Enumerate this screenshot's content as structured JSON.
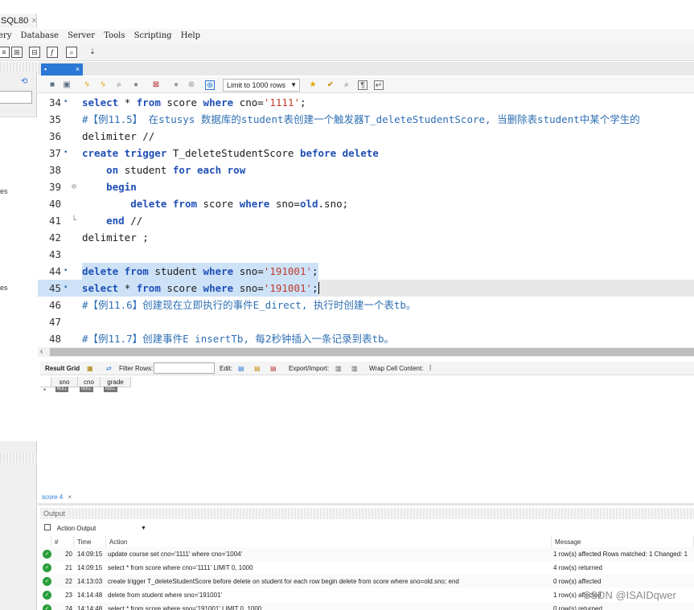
{
  "window_tab": {
    "title": "SQL80",
    "close": "×"
  },
  "menu": [
    "ery",
    "Database",
    "Server",
    "Tools",
    "Scripting",
    "Help"
  ],
  "left_panel": {
    "labels": [
      "es",
      "es"
    ]
  },
  "editor": {
    "tab_close": "×",
    "limit_select": "Limit to 1000 rows",
    "lines": [
      {
        "num": "34",
        "mark": "•",
        "tokens": [
          [
            "kw",
            "select "
          ],
          [
            "plain",
            "* "
          ],
          [
            "kw",
            "from "
          ],
          [
            "plain",
            "score "
          ],
          [
            "kw",
            "where "
          ],
          [
            "plain",
            "cno="
          ],
          [
            "str",
            "'1111'"
          ],
          [
            "plain",
            ";"
          ]
        ]
      },
      {
        "num": "35",
        "mark": "",
        "tokens": [
          [
            "cm",
            "#【例11.5】 在stusys 数据库的student表创建一个触发器T_deleteStudentScore, 当删除表student中某个学生的"
          ]
        ]
      },
      {
        "num": "36",
        "mark": "",
        "tokens": [
          [
            "plain",
            "delimiter //"
          ]
        ]
      },
      {
        "num": "37",
        "mark": "•",
        "tokens": [
          [
            "kw",
            "create trigger "
          ],
          [
            "plain",
            "T_deleteStudentScore "
          ],
          [
            "kw",
            "before delete"
          ]
        ]
      },
      {
        "num": "38",
        "mark": "",
        "tokens": [
          [
            "plain",
            "    "
          ],
          [
            "kw",
            "on "
          ],
          [
            "plain",
            "student "
          ],
          [
            "kw",
            "for each row"
          ]
        ]
      },
      {
        "num": "39",
        "mark": "",
        "fold": "⊖",
        "tokens": [
          [
            "plain",
            "    "
          ],
          [
            "kw",
            "begin"
          ]
        ]
      },
      {
        "num": "40",
        "mark": "",
        "tokens": [
          [
            "plain",
            "        "
          ],
          [
            "kw",
            "delete from "
          ],
          [
            "plain",
            "score "
          ],
          [
            "kw",
            "where "
          ],
          [
            "plain",
            "sno="
          ],
          [
            "kw",
            "old"
          ],
          [
            "plain",
            ".sno;"
          ]
        ]
      },
      {
        "num": "41",
        "mark": "",
        "fold": "└",
        "tokens": [
          [
            "plain",
            "    "
          ],
          [
            "kw",
            "end "
          ],
          [
            "plain",
            "//"
          ]
        ]
      },
      {
        "num": "42",
        "mark": "",
        "tokens": [
          [
            "plain",
            "delimiter ;"
          ]
        ]
      },
      {
        "num": "43",
        "mark": "",
        "tokens": [
          [
            "plain",
            ""
          ]
        ]
      },
      {
        "num": "44",
        "mark": "•",
        "sel": true,
        "tokens": [
          [
            "kw",
            "delete from "
          ],
          [
            "plain",
            "student "
          ],
          [
            "kw",
            "where "
          ],
          [
            "plain",
            "sno="
          ],
          [
            "str",
            "'191001'"
          ],
          [
            "plain",
            ";"
          ]
        ]
      },
      {
        "num": "45",
        "mark": "•",
        "sel": true,
        "cur": true,
        "tokens": [
          [
            "kw",
            "select "
          ],
          [
            "plain",
            "* "
          ],
          [
            "kw",
            "from "
          ],
          [
            "plain",
            "score "
          ],
          [
            "kw",
            "where "
          ],
          [
            "plain",
            "sno="
          ],
          [
            "str",
            "'191001'"
          ],
          [
            "plain",
            ";"
          ]
        ]
      },
      {
        "num": "46",
        "mark": "",
        "tokens": [
          [
            "cm",
            "#【例11.6】创建现在立即执行的事件E_direct, 执行时创建一个表tb。"
          ]
        ]
      },
      {
        "num": "47",
        "mark": "",
        "tokens": [
          [
            "plain",
            ""
          ]
        ]
      },
      {
        "num": "48",
        "mark": "",
        "tokens": [
          [
            "cm",
            "#【例11.7】创建事件E insertTb, 每2秒钟插入一条记录到表tb。"
          ]
        ]
      }
    ]
  },
  "result": {
    "toolbar": {
      "grid_label": "Result Grid",
      "filter_label": "Filter Rows:",
      "edit_label": "Edit:",
      "export_label": "Export/Import:",
      "wrap_label": "Wrap Cell Content:"
    },
    "columns": [
      "sno",
      "cno",
      "grade"
    ],
    "row_marker": "*",
    "null_label": "NULL"
  },
  "output": {
    "score_tab": "score 4",
    "score_tab_close": "×",
    "header": "Output",
    "select_value": "Action Output",
    "columns": {
      "num": "#",
      "time": "Time",
      "action": "Action",
      "message": "Message"
    },
    "rows": [
      {
        "num": "20",
        "time": "14:09:15",
        "action": "update course set cno='1111' where cno='1004'",
        "message": "1 row(s) affected Rows matched: 1  Changed: 1"
      },
      {
        "num": "21",
        "time": "14:09:15",
        "action": "select * from score where cno='1111' LIMIT 0, 1000",
        "message": "4 row(s) returned"
      },
      {
        "num": "22",
        "time": "14:13:03",
        "action": "create trigger T_deleteStudentScore before delete on student for each row     begin delete from score where sno=old.sno;     end",
        "message": "0 row(s) affected"
      },
      {
        "num": "23",
        "time": "14:14:48",
        "action": "delete from student where sno='191001'",
        "message": "1 row(s) affected"
      },
      {
        "num": "24",
        "time": "14:14:48",
        "action": "select * from score where sno='191001' LIMIT 0, 1000",
        "message": "0 row(s) returned"
      }
    ]
  },
  "watermark": "CSDN @ISAIDqwer"
}
